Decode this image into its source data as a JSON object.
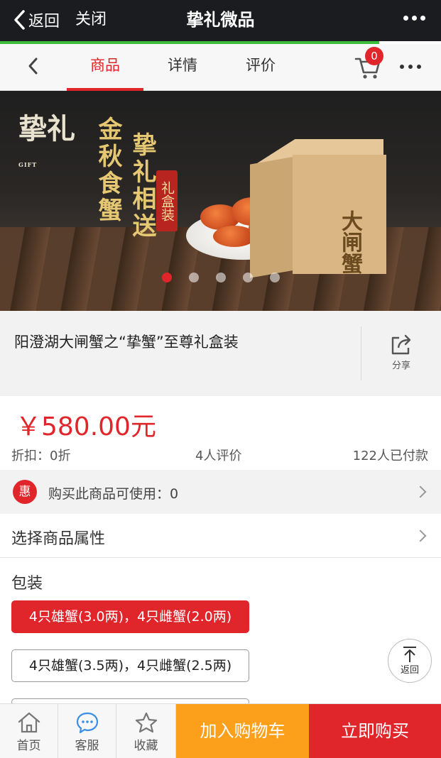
{
  "wechat_bar": {
    "back_label": "返回",
    "close_label": "关闭",
    "title": "挚礼微品"
  },
  "nav": {
    "tabs": [
      {
        "label": "商品",
        "active": true
      },
      {
        "label": "详情",
        "active": false
      },
      {
        "label": "评价",
        "active": false
      }
    ],
    "cart_count": "0"
  },
  "banner": {
    "brand": "挚礼",
    "brand_small": "GIFT",
    "headline_1": "金秋食蟹",
    "headline_2": "挚礼相送",
    "stamp": "礼盒装",
    "box_label": "大闸蟹",
    "slide_count": 5,
    "active_slide": 0
  },
  "product": {
    "title": "阳澄湖大闸蟹之“挚蟹”至尊礼盒装",
    "share_label": "分享",
    "price": "￥580.00元",
    "discount": "折扣：0折",
    "reviews": "4人评价",
    "paid": "122人已付款"
  },
  "coupon": {
    "badge": "惠",
    "text": "购买此商品可使用：0"
  },
  "attributes": {
    "select_label": "选择商品属性",
    "packaging_label": "包装",
    "options": [
      {
        "label": "4只雄蟹(3.0两)，4只雌蟹(2.0两)",
        "selected": true
      },
      {
        "label": "4只雄蟹(3.5两)，4只雌蟹(2.5两)",
        "selected": false
      }
    ]
  },
  "back_to_top": "返回",
  "bottom_bar": {
    "home": "首页",
    "service": "客服",
    "favorite": "收藏",
    "add_to_cart": "加入购物车",
    "buy_now": "立即购买"
  },
  "colors": {
    "accent_red": "#e0262b",
    "orange": "#fca01c",
    "wechat_green": "#3cbd3b"
  }
}
